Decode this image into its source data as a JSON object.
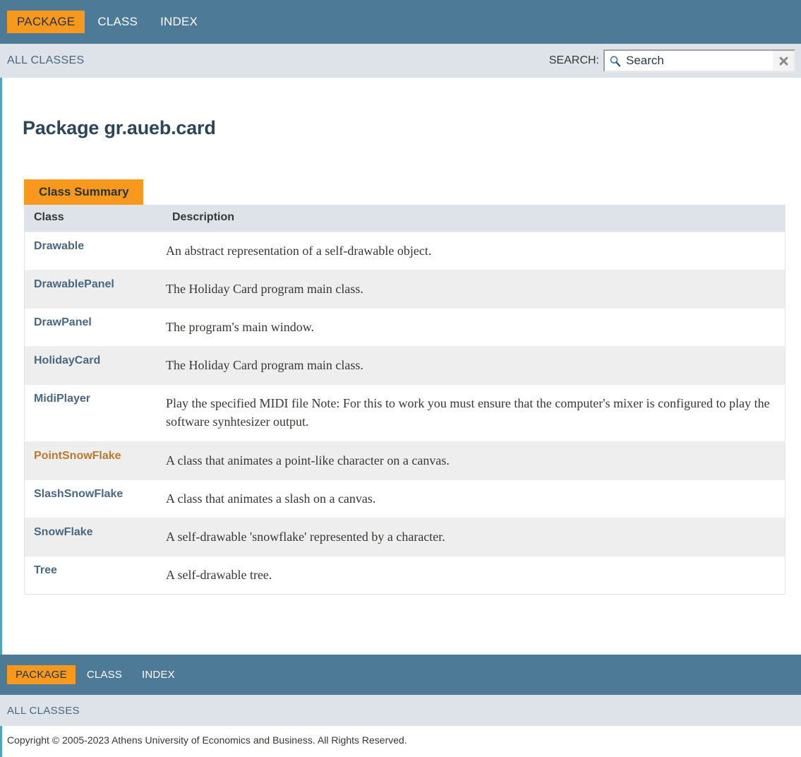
{
  "topnav": {
    "items": [
      {
        "label": "PACKAGE",
        "active": true
      },
      {
        "label": "CLASS",
        "active": false
      },
      {
        "label": "INDEX",
        "active": false
      }
    ]
  },
  "subnav": {
    "all_classes_label": "ALL CLASSES",
    "search_label": "SEARCH:",
    "search_value": "",
    "search_placeholder": "Search",
    "search_icon": "magnifier-icon",
    "clear_icon": "close-x-icon"
  },
  "main": {
    "page_title": "Package gr.aueb.card",
    "table": {
      "caption": "Class Summary",
      "headers": [
        "Class",
        "Description"
      ],
      "rows": [
        {
          "class_name": "Drawable",
          "description": "An abstract representation of a self-drawable object.",
          "visited": false
        },
        {
          "class_name": "DrawablePanel",
          "description": "The Holiday Card program main class.",
          "visited": false
        },
        {
          "class_name": "DrawPanel",
          "description": "The program's main window.",
          "visited": false
        },
        {
          "class_name": "HolidayCard",
          "description": "The Holiday Card program main class.",
          "visited": false
        },
        {
          "class_name": "MidiPlayer",
          "description": "Play the specified MIDI file Note: For this to work you must ensure that the computer's mixer is configured to play the software synhtesizer output.",
          "visited": false
        },
        {
          "class_name": "PointSnowFlake",
          "description": "A class that animates a point-like character on a canvas.",
          "visited": true
        },
        {
          "class_name": "SlashSnowFlake",
          "description": "A class that animates a slash on a canvas.",
          "visited": false
        },
        {
          "class_name": "SnowFlake",
          "description": "A self-drawable 'snowflake' represented by a character.",
          "visited": false
        },
        {
          "class_name": "Tree",
          "description": "A self-drawable tree.",
          "visited": false
        }
      ]
    }
  },
  "botnav": {
    "items": [
      {
        "label": "PACKAGE",
        "active": true
      },
      {
        "label": "CLASS",
        "active": false
      },
      {
        "label": "INDEX",
        "active": false
      }
    ]
  },
  "bottom_subnav": {
    "all_classes_label": "ALL CLASSES"
  },
  "footer": {
    "copyright": "Copyright © 2005-2023 Athens University of Economics and Business. All Rights Reserved."
  },
  "colors": {
    "navbar_blue": "#4D7A97",
    "accent_orange": "#F8981D",
    "subnav_gray": "#dee3e9",
    "link_blue": "#4A6782",
    "link_visited_orange": "#bb7a2a",
    "row_alt_gray": "#EEEEEF",
    "left_border_teal": "#49a6c1"
  }
}
